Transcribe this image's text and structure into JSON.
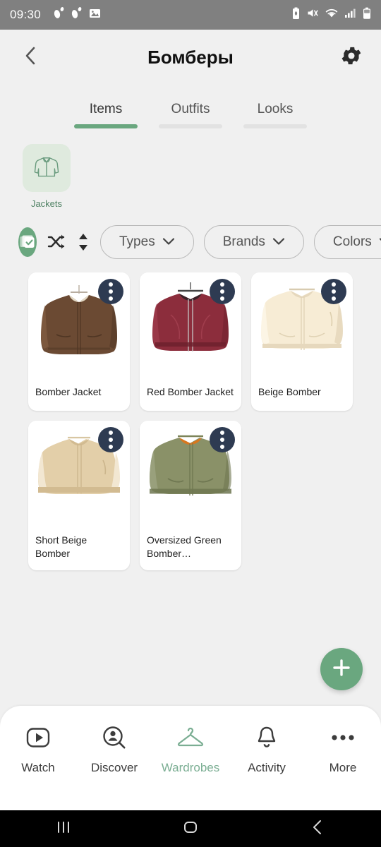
{
  "status_bar": {
    "time": "09:30",
    "left_icons": [
      "footsteps-icon",
      "footsteps-icon",
      "image-icon"
    ],
    "right_icons": [
      "battery-saver-icon",
      "mute-icon",
      "wifi-icon",
      "signal-icon",
      "battery-icon"
    ],
    "background": "#808080"
  },
  "header": {
    "back_icon": "chevron-left-icon",
    "title": "Бомберы",
    "settings_icon": "gear-icon"
  },
  "tabs": [
    {
      "label": "Items",
      "active": true
    },
    {
      "label": "Outfits",
      "active": false
    },
    {
      "label": "Looks",
      "active": false
    }
  ],
  "categories": [
    {
      "label": "Jackets",
      "icon": "jacket-icon",
      "selected": true
    }
  ],
  "toolbar": {
    "icons": [
      {
        "name": "multi-select-icon",
        "active": true
      },
      {
        "name": "shuffle-icon",
        "active": false
      },
      {
        "name": "sort-icon",
        "active": false
      }
    ],
    "filters": [
      {
        "label": "Types",
        "chevron": "chevron-down-icon"
      },
      {
        "label": "Brands",
        "chevron": "chevron-down-icon"
      },
      {
        "label": "Colors",
        "chevron": "chevron-down-icon"
      }
    ]
  },
  "items": [
    {
      "label": "Bomber Jacket",
      "color": "#6b4a33",
      "shade": "#4e3523",
      "light": "#8a6547"
    },
    {
      "label": "Red Bomber Jacket",
      "color": "#8c2d3c",
      "shade": "#6b1f2c",
      "light": "#a84454"
    },
    {
      "label": "Beige Bomber",
      "color": "#f7ecd5",
      "shade": "#e6d8bd",
      "light": "#fdf7e9"
    },
    {
      "label": "Short Beige Bomber",
      "color": "#e3cfa9",
      "shade": "#d2bb91",
      "light": "#f2e7d2"
    },
    {
      "label": "Oversized Green Bomber…",
      "color": "#8a9168",
      "shade": "#6f7751",
      "light": "#9ea583"
    }
  ],
  "fab": {
    "icon": "plus-icon",
    "color": "#6aa77f"
  },
  "bottom_nav": [
    {
      "label": "Watch",
      "icon": "play-box-icon",
      "active": false
    },
    {
      "label": "Discover",
      "icon": "person-search-icon",
      "active": false
    },
    {
      "label": "Wardrobes",
      "icon": "hanger-icon",
      "active": true
    },
    {
      "label": "Activity",
      "icon": "bell-icon",
      "active": false
    },
    {
      "label": "More",
      "icon": "more-dots-icon",
      "active": false
    }
  ],
  "android_nav": [
    {
      "icon": "recents-icon"
    },
    {
      "icon": "home-icon"
    },
    {
      "icon": "back-icon"
    }
  ],
  "theme": {
    "accent": "#6aa77f",
    "accent_light": "#dfeade",
    "page_bg": "#f0f0f0",
    "menu_dot_bg": "#2e3b52"
  }
}
